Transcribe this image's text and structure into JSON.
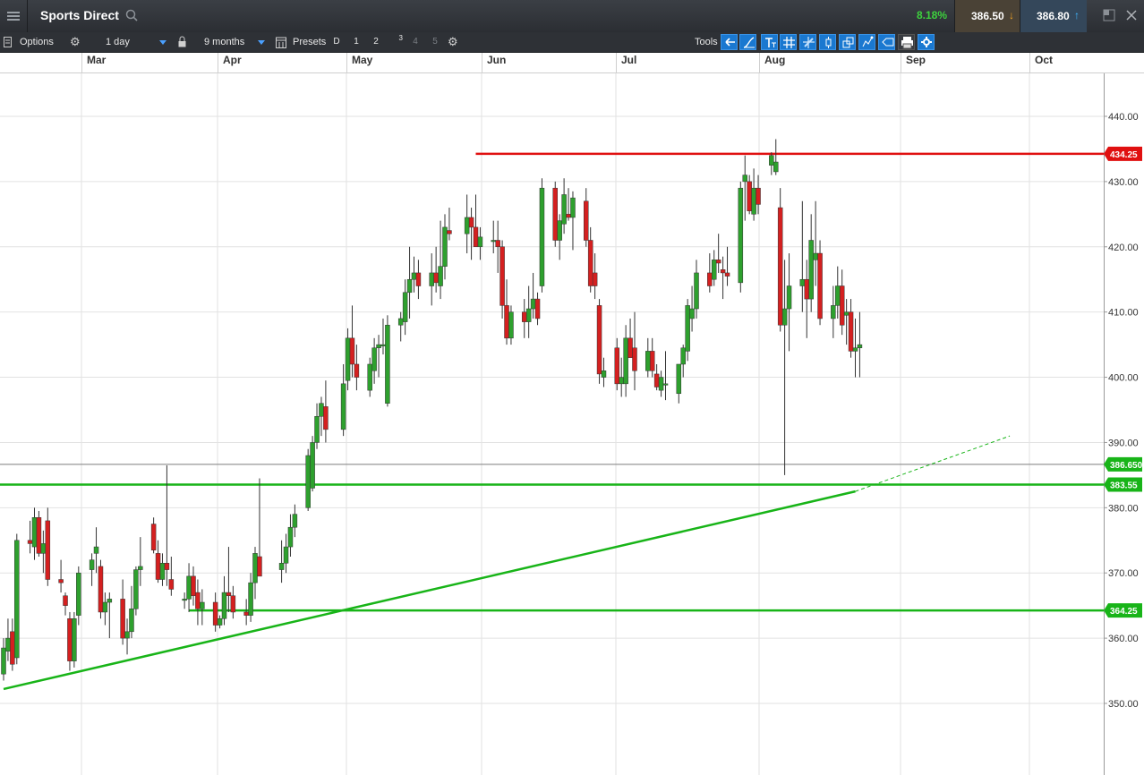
{
  "header": {
    "title": "Sports Direct",
    "change_pct": "8.18%",
    "sell_price": "386.50",
    "buy_price": "386.80",
    "colors": {
      "up": "#3dd23d",
      "sell_arrow": "#f5a623",
      "buy_arrow": "#3fb6ff"
    }
  },
  "toolbar": {
    "options_label": "Options",
    "interval_value": "1 day",
    "range_value": "9 months",
    "presets_label": "Presets",
    "preset_buttons": [
      "D",
      "1",
      "2",
      "3",
      "4",
      "5"
    ],
    "tools_label": "Tools",
    "tool_icons": [
      "back-arrow-icon",
      "curve-icon",
      "text-tool-icon",
      "grid-icon",
      "crosshair-icon",
      "candle-icon",
      "layers-icon",
      "indicator-icon",
      "tag-icon",
      "print-icon",
      "settings-tool-icon"
    ]
  },
  "chart_data": {
    "type": "candlestick",
    "title": "",
    "x_labels": [
      "Mar",
      "Apr",
      "May",
      "Jun",
      "Jul",
      "Aug",
      "Sep",
      "Oct"
    ],
    "y_ticks": [
      "440.00",
      "430.00",
      "420.00",
      "410.00",
      "400.00",
      "390.00",
      "380.00",
      "370.00",
      "360.00",
      "350.00"
    ],
    "ylim": [
      344,
      447
    ],
    "grid": true,
    "colors": {
      "up": "#2ea02e",
      "down": "#d42020",
      "resistance": "#e01010",
      "support": "#18b418"
    },
    "horizontal_lines": [
      {
        "name": "resistance",
        "value": 434.25,
        "label": "434.25",
        "color": "#e01010"
      },
      {
        "name": "support-upper",
        "value": 383.55,
        "label": "383.55",
        "color": "#18b418"
      },
      {
        "name": "support-lower",
        "value": 364.25,
        "label": "364.25",
        "color": "#18b418"
      },
      {
        "name": "current-price",
        "value": 386.65,
        "label": "386.650",
        "color": "#18b418"
      }
    ],
    "trendline": {
      "from": {
        "date": "Feb 14",
        "value": 352.2
      },
      "to": {
        "date": "Aug 26",
        "value": 382.5
      },
      "extended_to": {
        "date": "Sep 30",
        "value": 391.0
      }
    },
    "candles": [
      [
        "Feb 14",
        354.5,
        360.0,
        353.5,
        358.5
      ],
      [
        "Feb 15",
        358.0,
        363.0,
        356.5,
        360.0
      ],
      [
        "Feb 16",
        361.0,
        363.0,
        355.0,
        356.0
      ],
      [
        "Feb 17",
        357.0,
        376.0,
        356.0,
        375.0
      ],
      [
        "Feb 20",
        375.0,
        378.0,
        373.0,
        374.5
      ],
      [
        "Feb 21",
        374.0,
        380.0,
        372.0,
        378.5
      ],
      [
        "Feb 22",
        378.5,
        379.5,
        372.5,
        373.0
      ],
      [
        "Feb 23",
        373.0,
        376.5,
        370.0,
        374.5
      ],
      [
        "Feb 24",
        378.0,
        380.0,
        368.0,
        369.0
      ],
      [
        "Feb 27",
        369.0,
        372.0,
        367.0,
        368.5
      ],
      [
        "Feb 28",
        366.5,
        367.0,
        363.5,
        365.0
      ],
      [
        "Mar 01",
        363.0,
        364.0,
        355.0,
        356.5
      ],
      [
        "Mar 02",
        356.5,
        364.0,
        355.5,
        363.0
      ],
      [
        "Mar 03",
        363.5,
        371.0,
        362.0,
        370.0
      ],
      [
        "Mar 06",
        370.5,
        373.0,
        368.0,
        372.0
      ],
      [
        "Mar 07",
        373.0,
        377.0,
        370.0,
        374.0
      ],
      [
        "Mar 08",
        371.0,
        372.0,
        363.0,
        364.0
      ],
      [
        "Mar 09",
        364.0,
        367.0,
        362.0,
        365.5
      ],
      [
        "Mar 10",
        365.5,
        367.0,
        360.0,
        366.0
      ],
      [
        "Mar 13",
        366.0,
        369.0,
        359.0,
        360.0
      ],
      [
        "Mar 14",
        360.0,
        363.0,
        357.5,
        361.0
      ],
      [
        "Mar 15",
        361.0,
        368.0,
        360.0,
        364.5
      ],
      [
        "Mar 16",
        364.5,
        371.0,
        363.5,
        370.5
      ],
      [
        "Mar 17",
        370.5,
        375.5,
        368.0,
        371.0
      ],
      [
        "Mar 20",
        377.5,
        378.5,
        373.0,
        373.5
      ],
      [
        "Mar 21",
        373.0,
        375.0,
        368.5,
        369.0
      ],
      [
        "Mar 22",
        369.0,
        373.0,
        368.0,
        371.5
      ],
      [
        "Mar 23",
        371.5,
        386.5,
        368.0,
        370.5
      ],
      [
        "Mar 24",
        369.0,
        372.5,
        366.5,
        367.5
      ],
      [
        "Mar 27",
        366.0,
        367.0,
        364.5,
        366.0
      ],
      [
        "Mar 28",
        366.0,
        371.5,
        364.0,
        369.5
      ],
      [
        "Mar 29",
        369.5,
        371.0,
        365.0,
        366.5
      ],
      [
        "Mar 30",
        367.0,
        369.0,
        362.0,
        364.5
      ],
      [
        "Mar 31",
        364.5,
        367.5,
        362.0,
        365.5
      ],
      [
        "Apr 03",
        365.5,
        367.0,
        361.0,
        362.0
      ],
      [
        "Apr 04",
        362.0,
        363.5,
        361.5,
        363.0
      ],
      [
        "Apr 05",
        363.0,
        369.5,
        362.0,
        367.0
      ],
      [
        "Apr 06",
        367.0,
        374.0,
        364.0,
        366.5
      ],
      [
        "Apr 07",
        366.5,
        368.0,
        363.0,
        364.0
      ],
      [
        "Apr 10",
        364.0,
        366.0,
        362.0,
        363.5
      ],
      [
        "Apr 11",
        363.5,
        370.0,
        362.5,
        368.5
      ],
      [
        "Apr 12",
        368.5,
        374.0,
        366.0,
        373.0
      ],
      [
        "Apr 13",
        372.5,
        384.5,
        371.0,
        369.5
      ],
      [
        "Apr 18",
        370.5,
        375.0,
        368.5,
        371.5
      ],
      [
        "Apr 19",
        371.5,
        376.0,
        370.0,
        374.0
      ],
      [
        "Apr 20",
        374.0,
        379.0,
        372.5,
        377.0
      ],
      [
        "Apr 21",
        377.0,
        380.5,
        375.5,
        379.0
      ],
      [
        "Apr 24",
        380.0,
        389.0,
        379.5,
        388.0
      ],
      [
        "Apr 25",
        383.0,
        391.0,
        382.5,
        390.0
      ],
      [
        "Apr 26",
        390.0,
        396.0,
        389.0,
        394.0
      ],
      [
        "Apr 27",
        394.0,
        397.0,
        391.0,
        396.0
      ],
      [
        "Apr 28",
        395.5,
        399.5,
        390.0,
        392.0
      ],
      [
        "May 02",
        392.0,
        402.0,
        391.0,
        399.0
      ],
      [
        "May 03",
        399.5,
        407.5,
        398.0,
        406.0
      ],
      [
        "May 04",
        406.0,
        411.0,
        400.0,
        402.0
      ],
      [
        "May 05",
        402.0,
        405.0,
        398.0,
        400.0
      ],
      [
        "May 08",
        398.0,
        403.0,
        397.0,
        402.0
      ],
      [
        "May 09",
        401.0,
        406.0,
        399.0,
        404.5
      ],
      [
        "May 10",
        404.5,
        406.5,
        400.0,
        405.0
      ],
      [
        "May 11",
        405.0,
        409.0,
        403.5,
        405.0
      ],
      [
        "May 12",
        396.0,
        409.5,
        395.5,
        408.0
      ],
      [
        "May 15",
        408.0,
        410.0,
        405.5,
        409.0
      ],
      [
        "May 16",
        408.5,
        415.0,
        406.5,
        413.0
      ],
      [
        "May 17",
        413.0,
        420.0,
        409.0,
        415.0
      ],
      [
        "May 18",
        415.0,
        418.5,
        413.0,
        416.0
      ],
      [
        "May 19",
        416.0,
        418.0,
        412.0,
        414.0
      ],
      [
        "May 22",
        414.0,
        419.0,
        411.0,
        416.0
      ],
      [
        "May 23",
        416.0,
        420.0,
        413.0,
        414.5
      ],
      [
        "May 24",
        414.0,
        424.0,
        412.0,
        417.0
      ],
      [
        "May 25",
        417.0,
        425.0,
        415.0,
        423.0
      ],
      [
        "May 26",
        422.5,
        426.0,
        421.0,
        422.0
      ],
      [
        "May 30",
        422.0,
        428.0,
        419.0,
        424.5
      ],
      [
        "May 31",
        424.5,
        426.0,
        418.0,
        423.0
      ],
      [
        "Jun 01",
        423.0,
        428.0,
        420.0,
        420.0
      ],
      [
        "Jun 02",
        420.0,
        423.0,
        418.0,
        421.5
      ],
      [
        "Jun 05",
        421.0,
        424.0,
        419.0,
        421.0
      ],
      [
        "Jun 06",
        421.0,
        424.0,
        416.0,
        420.0
      ],
      [
        "Jun 07",
        420.0,
        421.0,
        409.0,
        411.0
      ],
      [
        "Jun 08",
        411.0,
        415.0,
        405.0,
        406.0
      ],
      [
        "Jun 09",
        406.0,
        411.0,
        405.0,
        410.0
      ],
      [
        "Jun 12",
        410.0,
        412.0,
        406.0,
        408.5
      ],
      [
        "Jun 13",
        408.5,
        414.0,
        406.0,
        410.5
      ],
      [
        "Jun 14",
        410.5,
        416.0,
        409.0,
        412.0
      ],
      [
        "Jun 15",
        412.0,
        413.0,
        408.0,
        409.0
      ],
      [
        "Jun 16",
        414.0,
        430.5,
        413.0,
        429.0
      ],
      [
        "Jun 19",
        429.0,
        430.0,
        420.0,
        421.0
      ],
      [
        "Jun 20",
        421.0,
        425.0,
        418.0,
        424.0
      ],
      [
        "Jun 21",
        423.5,
        430.5,
        422.0,
        428.0
      ],
      [
        "Jun 22",
        425.0,
        429.0,
        424.0,
        424.5
      ],
      [
        "Jun 23",
        424.5,
        428.5,
        419.5,
        427.5
      ],
      [
        "Jun 26",
        427.0,
        429.0,
        420.0,
        421.0
      ],
      [
        "Jun 27",
        421.0,
        423.0,
        413.0,
        414.0
      ],
      [
        "Jun 28",
        416.0,
        419.0,
        412.0,
        414.0
      ],
      [
        "Jun 29",
        411.0,
        412.0,
        399.0,
        400.5
      ],
      [
        "Jun 30",
        400.0,
        403.0,
        398.5,
        401.0
      ],
      [
        "Jul 03",
        404.5,
        406.0,
        398.0,
        399.0
      ],
      [
        "Jul 04",
        399.0,
        403.0,
        397.0,
        400.0
      ],
      [
        "Jul 05",
        399.0,
        408.0,
        397.0,
        406.0
      ],
      [
        "Jul 06",
        406.0,
        409.0,
        404.0,
        403.0
      ],
      [
        "Jul 07",
        404.5,
        410.0,
        398.0,
        401.0
      ],
      [
        "Jul 10",
        401.0,
        406.0,
        400.0,
        404.0
      ],
      [
        "Jul 11",
        404.0,
        406.0,
        400.0,
        401.0
      ],
      [
        "Jul 12",
        400.5,
        402.0,
        398.0,
        398.5
      ],
      [
        "Jul 13",
        398.0,
        401.0,
        397.0,
        400.0
      ],
      [
        "Jul 14",
        399.0,
        404.0,
        396.5,
        399.0
      ],
      [
        "Jul 17",
        397.5,
        400.0,
        396.0,
        402.0
      ],
      [
        "Jul 18",
        402.0,
        405.0,
        400.0,
        404.5
      ],
      [
        "Jul 19",
        404.0,
        412.0,
        402.5,
        411.0
      ],
      [
        "Jul 20",
        409.0,
        414.0,
        407.0,
        410.5
      ],
      [
        "Jul 21",
        410.5,
        418.0,
        409.0,
        416.0
      ],
      [
        "Jul 24",
        416.0,
        419.0,
        413.0,
        414.0
      ],
      [
        "Jul 25",
        415.0,
        419.5,
        414.0,
        418.0
      ],
      [
        "Jul 26",
        418.0,
        422.0,
        416.0,
        417.5
      ],
      [
        "Jul 27",
        416.5,
        418.5,
        412.0,
        416.0
      ],
      [
        "Jul 28",
        416.0,
        420.0,
        414.0,
        415.5
      ],
      [
        "Jul 31",
        414.5,
        430.0,
        413.0,
        429.0
      ],
      [
        "Aug 01",
        430.0,
        434.0,
        424.0,
        431.0
      ],
      [
        "Aug 02",
        430.0,
        431.0,
        425.0,
        425.5
      ],
      [
        "Aug 03",
        425.0,
        432.0,
        424.0,
        429.0
      ],
      [
        "Aug 04",
        429.0,
        431.0,
        425.0,
        426.5
      ],
      [
        "Aug 07",
        432.5,
        434.5,
        431.0,
        434.0
      ],
      [
        "Aug 08",
        431.5,
        436.5,
        431.0,
        433.0
      ],
      [
        "Aug 09",
        426.0,
        429.0,
        407.0,
        408.0
      ],
      [
        "Aug 10",
        408.0,
        418.0,
        385.0,
        410.5
      ],
      [
        "Aug 11",
        410.5,
        419.0,
        404.0,
        414.0
      ],
      [
        "Aug 14",
        414.0,
        427.0,
        410.0,
        415.0
      ],
      [
        "Aug 15",
        415.0,
        418.0,
        406.0,
        412.0
      ],
      [
        "Aug 16",
        412.0,
        425.0,
        410.0,
        421.0
      ],
      [
        "Aug 17",
        418.0,
        427.0,
        414.0,
        419.0
      ],
      [
        "Aug 18",
        419.0,
        421.0,
        408.0,
        409.0
      ],
      [
        "Aug 21",
        409.0,
        414.0,
        406.0,
        411.0
      ],
      [
        "Aug 22",
        411.0,
        417.0,
        409.0,
        414.0
      ],
      [
        "Aug 23",
        414.0,
        416.5,
        406.5,
        408.0
      ],
      [
        "Aug 24",
        409.5,
        412.0,
        405.0,
        410.0
      ],
      [
        "Aug 25",
        410.0,
        412.0,
        403.0,
        404.0
      ],
      [
        "Aug 26",
        404.0,
        409.0,
        400.0,
        404.5
      ],
      [
        "Aug 27",
        404.5,
        410.0,
        400.0,
        405.0
      ]
    ]
  }
}
